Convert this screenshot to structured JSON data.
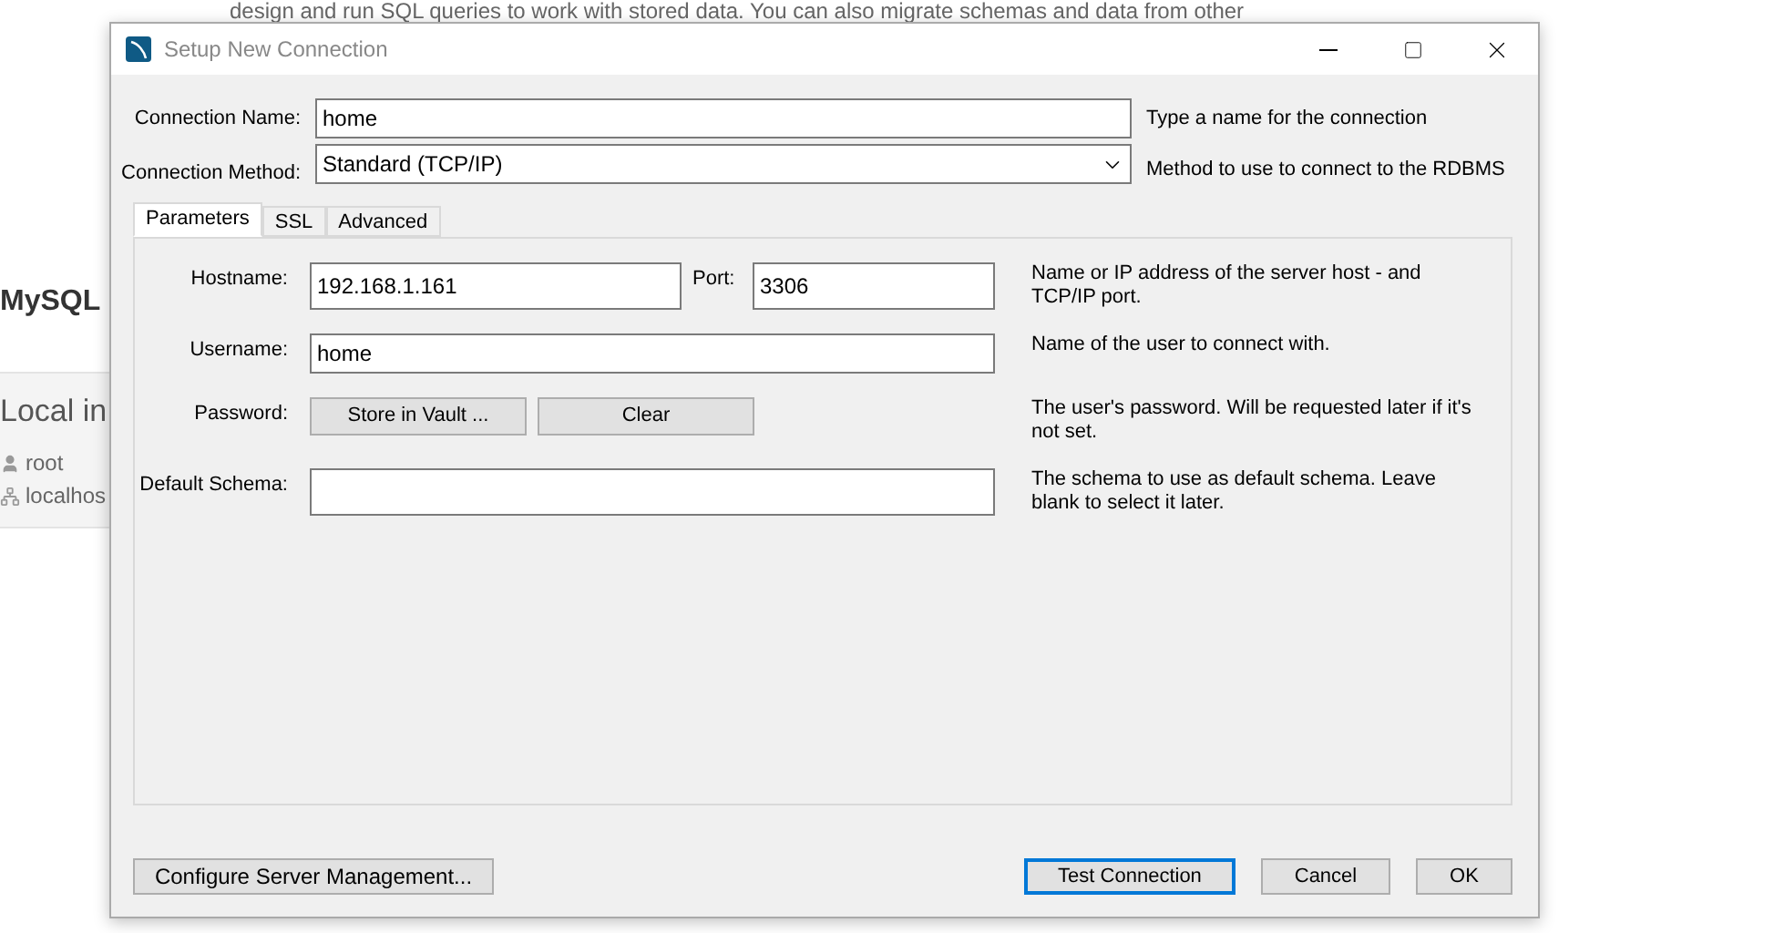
{
  "background": {
    "intro_text": "design and run SQL queries to work with stored data. You can also migrate schemas and data from other",
    "heading": "MySQL",
    "card": {
      "title": "Local in",
      "user": "root",
      "host": "localhos"
    }
  },
  "dialog": {
    "title": "Setup New Connection",
    "connection_name": {
      "label": "Connection Name:",
      "value": "home",
      "help": "Type a name for the connection"
    },
    "connection_method": {
      "label": "Connection Method:",
      "value": "Standard (TCP/IP)",
      "help": "Method to use to connect to the RDBMS"
    },
    "tabs": [
      {
        "label": "Parameters",
        "selected": true
      },
      {
        "label": "SSL",
        "selected": false
      },
      {
        "label": "Advanced",
        "selected": false
      }
    ],
    "parameters": [
      {
        "kind": "host_port",
        "label": "Hostname:",
        "value": "192.168.1.161",
        "port_label": "Port:",
        "port_value": "3306",
        "help": "Name or IP address of the server host - and TCP/IP port."
      },
      {
        "kind": "input",
        "label": "Username:",
        "value": "home",
        "help": "Name of the user to connect with."
      },
      {
        "kind": "buttons",
        "label": "Password:",
        "buttons": [
          "Store in Vault ...",
          "Clear"
        ],
        "help": "The user's password. Will be requested later if it's not set."
      },
      {
        "kind": "input",
        "label": "Default Schema:",
        "help": "The schema to use as default schema. Leave blank to select it later."
      }
    ],
    "left_button": "Configure Server Management...",
    "buttons": [
      {
        "label": "Test Connection",
        "focused": true
      },
      {
        "label": "Cancel",
        "focused": false
      },
      {
        "label": "OK",
        "focused": false
      }
    ]
  }
}
